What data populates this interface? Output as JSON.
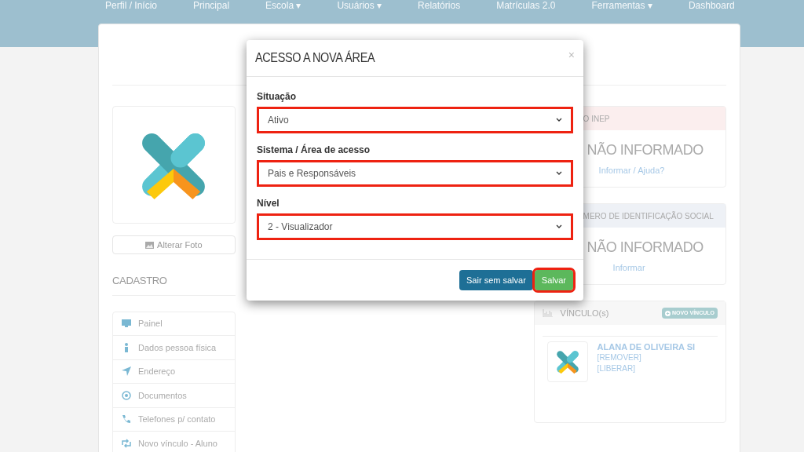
{
  "nav": [
    "Perfil / Início",
    "Principal",
    "Escola ▾",
    "Usuários ▾",
    "Relatórios",
    "Matrículas 2.0",
    "Ferramentas ▾",
    "Dashboard"
  ],
  "profile": {
    "photo_button": "Alterar Foto",
    "section_title": "CADASTRO",
    "menu": [
      {
        "label": "Painel"
      },
      {
        "label": "Dados pessoa física"
      },
      {
        "label": "Endereço"
      },
      {
        "label": "Documentos"
      },
      {
        "label": "Telefones p/ contato"
      },
      {
        "label": "Novo vínculo - Aluno"
      }
    ]
  },
  "cards": [
    {
      "title": "O INEP",
      "value": "NÃO INFORMADO",
      "link": "Informar / Ajuda?"
    },
    {
      "title": "MERO DE IDENTIFICAÇÃO SOCIAL",
      "value": "NÃO INFORMADO",
      "link": "Informar"
    }
  ],
  "links_panel": {
    "title": "VÍNCULO(s)",
    "button": "NOVO VÍNCULO",
    "entries": [
      {
        "name": "ALANA DE OLIVEIRA SI",
        "actions": [
          "[REMOVER]",
          "[LIBERAR]"
        ]
      }
    ]
  },
  "modal": {
    "title": "ACESSO A NOVA ÁREA",
    "close": "×",
    "fields": [
      {
        "label": "Situação",
        "value": "Ativo",
        "highlighted": true
      },
      {
        "label": "Sistema / Área de acesso",
        "value": "Pais e Responsáveis",
        "highlighted": true
      },
      {
        "label": "Nível",
        "value": "2 - Visualizador",
        "highlighted": true
      }
    ],
    "buttons": [
      {
        "label": "Sair sem salvar",
        "kind": "secondary",
        "highlighted": false
      },
      {
        "label": "Salvar",
        "kind": "primary",
        "highlighted": true
      }
    ]
  }
}
